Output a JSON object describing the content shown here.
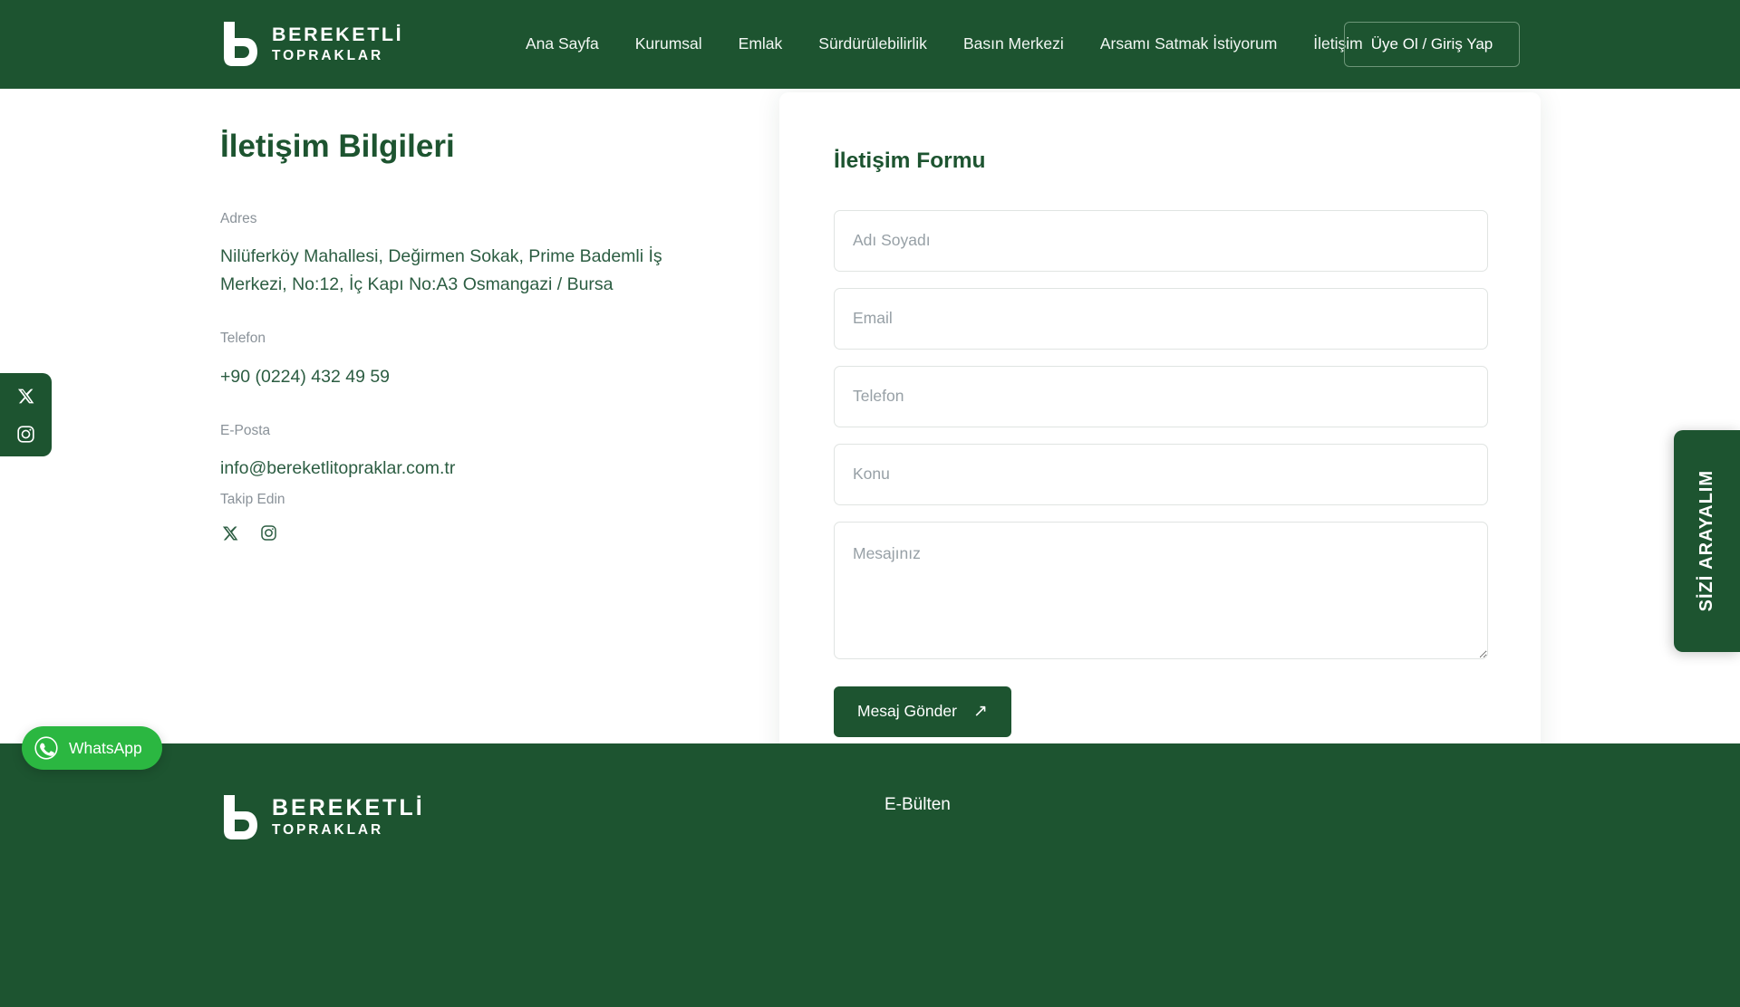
{
  "theme": {
    "brand_green": "#1d5430",
    "text_green": "#2c5d42",
    "muted_gray": "#8a9299",
    "whatsapp_green": "#2bb741",
    "page_bg": "#ffffff"
  },
  "header": {
    "logo": {
      "line1": "BEREKETLİ",
      "line2": "TOPRAKLAR"
    },
    "nav": [
      {
        "label": "Ana Sayfa",
        "name": "nav-item-ana-sayfa"
      },
      {
        "label": "Kurumsal",
        "name": "nav-item-kurumsal"
      },
      {
        "label": "Emlak",
        "name": "nav-item-emlak"
      },
      {
        "label": "Sürdürülebilirlik",
        "name": "nav-item-surdurulebilirlik"
      },
      {
        "label": "Basın Merkezi",
        "name": "nav-item-basin-merkezi"
      },
      {
        "label": "Arsamı Satmak İstiyorum",
        "name": "nav-item-arsami-satmak-istiyorum"
      },
      {
        "label": "İletişim",
        "name": "nav-item-iletisim"
      }
    ],
    "login_button": "Üye Ol / Giriş Yap"
  },
  "contact_info": {
    "title": "İletişim Bilgileri",
    "address_label": "Adres",
    "address_value": "Nilüferköy Mahallesi, Değirmen Sokak, Prime Bademli İş Merkezi, No:12, İç Kapı No:A3 Osmangazi / Bursa",
    "phone_label": "Telefon",
    "phone_value": "+90 (0224) 432 49 59",
    "email_label": "E-Posta",
    "email_value": "info@bereketlitopraklar.com.tr",
    "follow_label": "Takip Edin",
    "social": [
      {
        "name": "x-twitter-icon",
        "label": "X"
      },
      {
        "name": "instagram-icon",
        "label": "Instagram"
      }
    ]
  },
  "form": {
    "title": "İletişim Formu",
    "fields": [
      {
        "name": "full-name-input",
        "placeholder": "Adı Soyadı",
        "value": ""
      },
      {
        "name": "email-input",
        "placeholder": "Email",
        "value": ""
      },
      {
        "name": "phone-input",
        "placeholder": "Telefon",
        "value": ""
      },
      {
        "name": "subject-input",
        "placeholder": "Konu",
        "value": ""
      }
    ],
    "message": {
      "placeholder": "Mesajınız",
      "value": ""
    },
    "submit_label": "Mesaj Gönder",
    "submit_arrow": "↗"
  },
  "side_dock": {
    "items": [
      {
        "name": "x-twitter-icon",
        "label": "X"
      },
      {
        "name": "instagram-icon",
        "label": "Instagram"
      }
    ]
  },
  "callback_tab": {
    "label": "SİZİ ARAYALIM"
  },
  "whatsapp": {
    "label": "WhatsApp"
  },
  "footer": {
    "logo": {
      "line1": "BEREKETLİ",
      "line2": "TOPRAKLAR"
    },
    "newsletter_title": "E-Bülten"
  }
}
